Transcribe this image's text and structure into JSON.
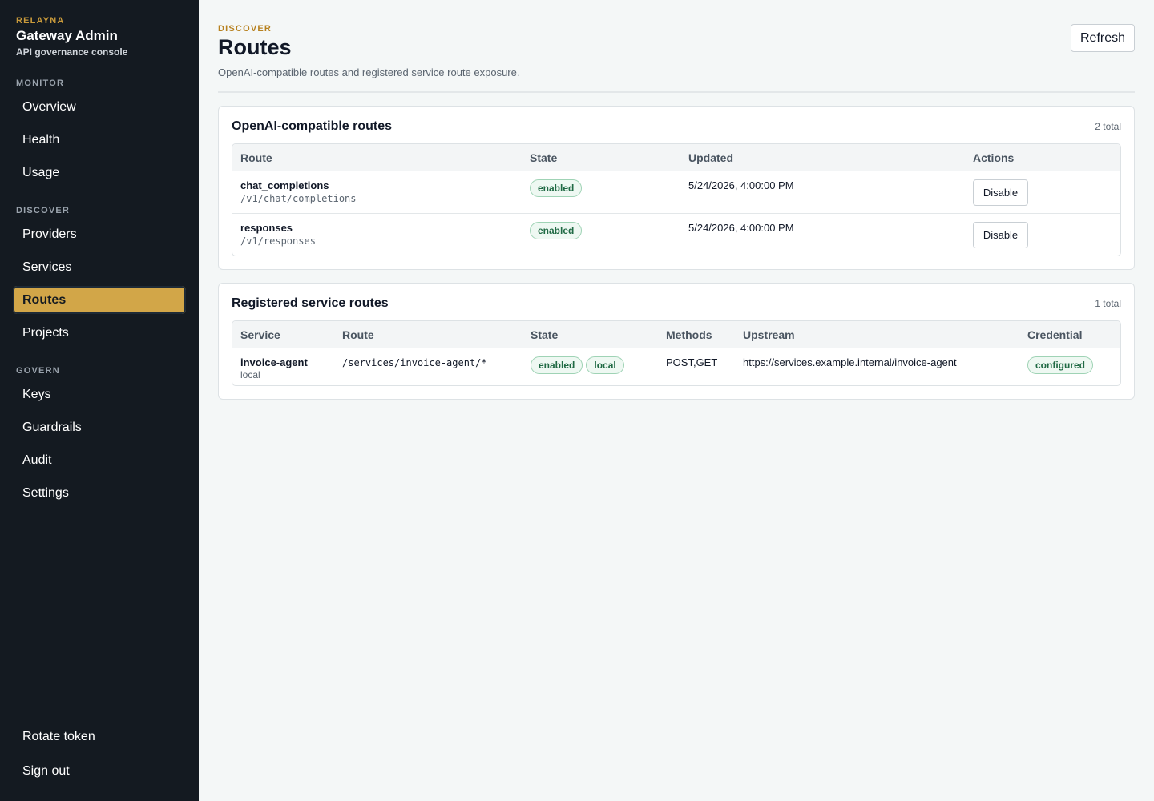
{
  "brand": {
    "kicker": "RELAYNA",
    "title": "Gateway Admin",
    "subtitle": "API governance console"
  },
  "nav": {
    "monitor_label": "MONITOR",
    "monitor": [
      "Overview",
      "Health",
      "Usage"
    ],
    "discover_label": "DISCOVER",
    "discover": [
      "Providers",
      "Services",
      "Routes",
      "Projects"
    ],
    "govern_label": "GOVERN",
    "govern": [
      "Keys",
      "Guardrails",
      "Audit",
      "Settings"
    ],
    "active": "Routes",
    "bottom": [
      "Rotate token",
      "Sign out"
    ]
  },
  "header": {
    "kicker": "DISCOVER",
    "title": "Routes",
    "subtitle": "OpenAI-compatible routes and registered service route exposure.",
    "refresh_label": "Refresh"
  },
  "openai_routes": {
    "title": "OpenAI-compatible routes",
    "count": "2 total",
    "columns": [
      "Route",
      "State",
      "Updated",
      "Actions"
    ],
    "rows": [
      {
        "name": "chat_completions",
        "path": "/v1/chat/completions",
        "state": "enabled",
        "updated": "5/24/2026, 4:00:00 PM",
        "action": "Disable"
      },
      {
        "name": "responses",
        "path": "/v1/responses",
        "state": "enabled",
        "updated": "5/24/2026, 4:00:00 PM",
        "action": "Disable"
      }
    ]
  },
  "service_routes": {
    "title": "Registered service routes",
    "count": "1 total",
    "columns": [
      "Service",
      "Route",
      "State",
      "Methods",
      "Upstream",
      "Credential"
    ],
    "rows": [
      {
        "service": "invoice-agent",
        "service_sub": "local",
        "route": "/services/invoice-agent/*",
        "state": "enabled",
        "scope": "local",
        "methods": "POST,GET",
        "upstream": "https://services.example.internal/invoice-agent",
        "credential": "configured"
      }
    ]
  },
  "colors": {
    "sidebar_bg": "#141a21",
    "accent": "#d2a648",
    "kicker": "#b7811f",
    "badge_green": "#206a44"
  }
}
